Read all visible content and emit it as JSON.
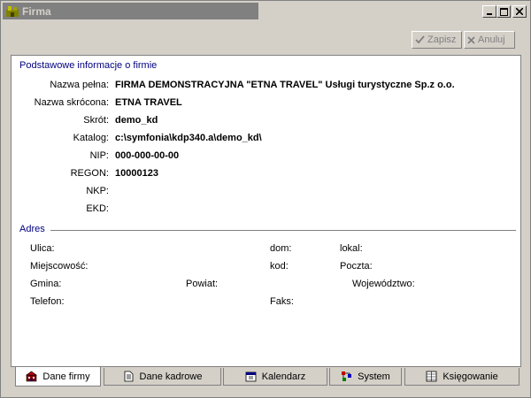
{
  "window": {
    "title": "Firma"
  },
  "toolbar": {
    "save_label": "Zapisz",
    "cancel_label": "Anuluj"
  },
  "basic": {
    "section_title": "Podstawowe informacje o firmie",
    "fields": [
      {
        "label": "Nazwa pełna:",
        "value": "FIRMA DEMONSTRACYJNA \"ETNA TRAVEL\" Usługi turystyczne Sp.z o.o."
      },
      {
        "label": "Nazwa skrócona:",
        "value": "ETNA TRAVEL"
      },
      {
        "label": "Skrót:",
        "value": "demo_kd"
      },
      {
        "label": "Katalog:",
        "value": "c:\\symfonia\\kdp340.a\\demo_kd\\"
      },
      {
        "label": "NIP:",
        "value": "000-000-00-00"
      },
      {
        "label": "REGON:",
        "value": "10000123"
      },
      {
        "label": "NKP:",
        "value": ""
      },
      {
        "label": "EKD:",
        "value": ""
      }
    ]
  },
  "address": {
    "section_title": "Adres",
    "ulica": "Ulica:",
    "dom": "dom:",
    "lokal": "lokal:",
    "miejscowosc": "Miejscowość:",
    "kod": "kod:",
    "poczta": "Poczta:",
    "gmina": "Gmina:",
    "powiat": "Powiat:",
    "wojewodztwo": "Województwo:",
    "telefon": "Telefon:",
    "faks": "Faks:"
  },
  "tabs": [
    {
      "label": "Dane firmy",
      "icon": "company-icon",
      "active": true
    },
    {
      "label": "Dane kadrowe",
      "icon": "document-icon",
      "active": false
    },
    {
      "label": "Kalendarz",
      "icon": "calendar-icon",
      "active": false
    },
    {
      "label": "System",
      "icon": "system-icon",
      "active": false
    },
    {
      "label": "Księgowanie",
      "icon": "ledger-icon",
      "active": false
    }
  ]
}
